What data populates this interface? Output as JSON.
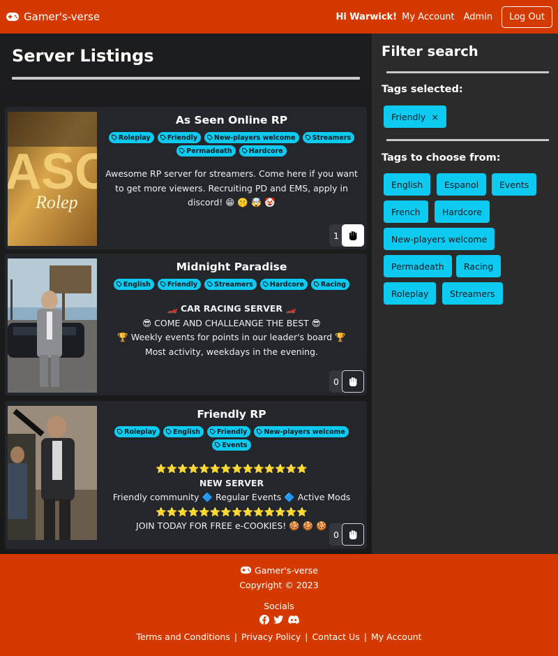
{
  "nav": {
    "brand": "Gamer's-verse",
    "greeting": "Hi Warwick!",
    "my_account": "My Account",
    "admin": "Admin",
    "logout": "Log Out"
  },
  "main": {
    "title": "Server Listings",
    "servers": [
      {
        "name": "As Seen Online RP",
        "tags": [
          "Roleplay",
          "Friendly",
          "New-players welcome",
          "Streamers",
          "Permadeath",
          "Hardcore"
        ],
        "desc": [
          "Awesome RP server for streamers. Come here if you want to get more viewers. Recruiting PD and EMS, apply in discord! 😁 🤫 🤯 🤡"
        ],
        "likes": "1"
      },
      {
        "name": "Midnight Paradise",
        "tags": [
          "English",
          "Friendly",
          "Streamers",
          "Hardcore",
          "Racing"
        ],
        "desc": [
          "🏎️  CAR RACING SERVER  🏎️",
          "😎 COME AND CHALLEANGE THE BEST 😎",
          "🏆 Weekly events for points in our leader's board 🏆",
          "Most activity, weekdays in the evening."
        ],
        "likes": "0"
      },
      {
        "name": "Friendly RP",
        "tags": [
          "Roleplay",
          "English",
          "Friendly",
          "New-players welcome",
          "Events"
        ],
        "desc": [
          "⭐⭐⭐⭐⭐⭐⭐⭐⭐⭐⭐⭐⭐⭐",
          "NEW SERVER",
          "Friendly community 🔷 Regular Events 🔷 Active Mods",
          "⭐⭐⭐⭐⭐⭐⭐⭐⭐⭐⭐⭐⭐⭐",
          "JOIN TODAY FOR FREE e-COOKIES! 🍪 🍪 🍪"
        ],
        "likes": "0"
      }
    ]
  },
  "sidebar": {
    "title": "Filter search",
    "selected_heading": "Tags selected:",
    "selected": [
      "Friendly"
    ],
    "remove_glyph": "×",
    "choose_heading": "Tags to choose from:",
    "choose": [
      "English",
      "Espanol",
      "Events",
      "French",
      "Hardcore",
      "New-players welcome",
      "Permadeath",
      "Racing",
      "Roleplay",
      "Streamers"
    ]
  },
  "footer": {
    "brand": "Gamer's-verse",
    "copyright": "Copyright © 2023",
    "socials": "Socials",
    "links": [
      "Terms and Conditions",
      "Privacy Policy",
      "Contact Us",
      "My Account"
    ],
    "sep": "|"
  },
  "colors": {
    "accent": "#d43a00",
    "tag": "#0dcaf0",
    "card": "#23272c",
    "sidebar": "#2b2b2b"
  }
}
